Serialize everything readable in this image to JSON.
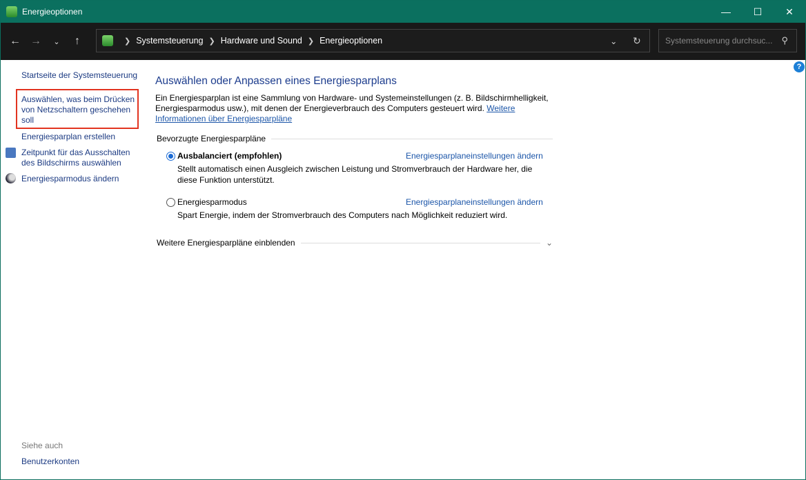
{
  "window": {
    "title": "Energieoptionen"
  },
  "address": {
    "crumbs": [
      "Systemsteuerung",
      "Hardware und Sound",
      "Energieoptionen"
    ]
  },
  "search": {
    "placeholder": "Systemsteuerung durchsuc..."
  },
  "sidebar": {
    "items": [
      {
        "label": "Startseite der Systemsteuerung"
      },
      {
        "label": "Auswählen, was beim Drücken von Netzschaltern geschehen soll"
      },
      {
        "label": "Energiesparplan erstellen"
      },
      {
        "label": "Zeitpunkt für das Ausschalten des Bildschirms auswählen"
      },
      {
        "label": "Energiesparmodus ändern"
      }
    ],
    "see_also": "Siehe auch",
    "see_also_items": [
      {
        "label": "Benutzerkonten"
      }
    ]
  },
  "main": {
    "title": "Auswählen oder Anpassen eines Energiesparplans",
    "description": "Ein Energiesparplan ist eine Sammlung von Hardware- und Systemeinstellungen (z. B. Bildschirmhelligkeit, Energiesparmodus usw.), mit denen der Energieverbrauch des Computers gesteuert wird.",
    "more_link": "Weitere Informationen über Energiesparpläne",
    "group_label": "Bevorzugte Energiesparpläne",
    "plans": [
      {
        "name": "Ausbalanciert (empfohlen)",
        "selected": true,
        "desc": "Stellt automatisch einen Ausgleich zwischen Leistung und Stromverbrauch der Hardware her, die diese Funktion unterstützt.",
        "link": "Energiesparplaneinstellungen ändern"
      },
      {
        "name": "Energiesparmodus",
        "selected": false,
        "desc": "Spart Energie, indem der Stromverbrauch des Computers nach Möglichkeit reduziert wird.",
        "link": "Energiesparplaneinstellungen ändern"
      }
    ],
    "show_more": "Weitere Energiesparpläne einblenden"
  },
  "help": "?"
}
